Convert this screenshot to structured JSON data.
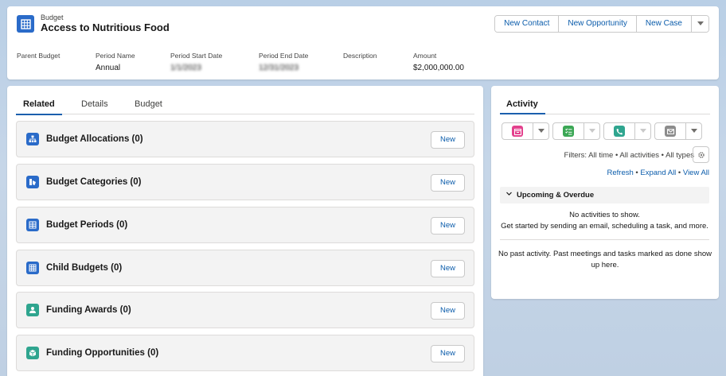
{
  "header": {
    "record_type": "Budget",
    "title": "Access to Nutritious Food",
    "actions": [
      "New Contact",
      "New Opportunity",
      "New Case"
    ],
    "fields": [
      {
        "label": "Parent Budget",
        "value": ""
      },
      {
        "label": "Period Name",
        "value": "Annual"
      },
      {
        "label": "Period Start Date",
        "value": "1/1/2023"
      },
      {
        "label": "Period End Date",
        "value": "12/31/2023"
      },
      {
        "label": "Description",
        "value": ""
      },
      {
        "label": "Amount",
        "value": "$2,000,000.00"
      }
    ]
  },
  "main": {
    "tabs": [
      "Related",
      "Details",
      "Budget"
    ],
    "active_tab": "Related",
    "related_lists": [
      {
        "title": "Budget Allocations (0)",
        "new_label": "New",
        "icon": "hierarchy-icon",
        "color": "#2a6bc9"
      },
      {
        "title": "Budget Categories (0)",
        "new_label": "New",
        "icon": "category-icon",
        "color": "#2a6bc9"
      },
      {
        "title": "Budget Periods (0)",
        "new_label": "New",
        "icon": "calendar-grid-icon",
        "color": "#2a6bc9"
      },
      {
        "title": "Child Budgets (0)",
        "new_label": "New",
        "icon": "table-icon",
        "color": "#2a6bc9"
      },
      {
        "title": "Funding Awards (0)",
        "new_label": "New",
        "icon": "award-icon",
        "color": "#2fa58f"
      },
      {
        "title": "Funding Opportunities (0)",
        "new_label": "New",
        "icon": "box-icon",
        "color": "#2fa58f"
      }
    ]
  },
  "activity": {
    "tab": "Activity",
    "buttons": [
      {
        "icon": "event-icon",
        "color": "#e3418d"
      },
      {
        "icon": "task-icon",
        "color": "#3ba755"
      },
      {
        "icon": "call-icon",
        "color": "#2fa58f"
      },
      {
        "icon": "email-icon",
        "color": "#8c8c8c"
      }
    ],
    "filters": "Filters: All time • All activities • All types",
    "links": {
      "refresh": "Refresh",
      "expand": "Expand All",
      "view": "View All",
      "sep": " • "
    },
    "upcoming_title": "Upcoming & Overdue",
    "no_activities": "No activities to show.",
    "get_started": "Get started by sending an email, scheduling a task, and more.",
    "past_activity": "No past activity. Past meetings and tasks marked as done show up here."
  },
  "colors": {
    "brand": "#0b5cab",
    "accent": "#1b5fad"
  }
}
